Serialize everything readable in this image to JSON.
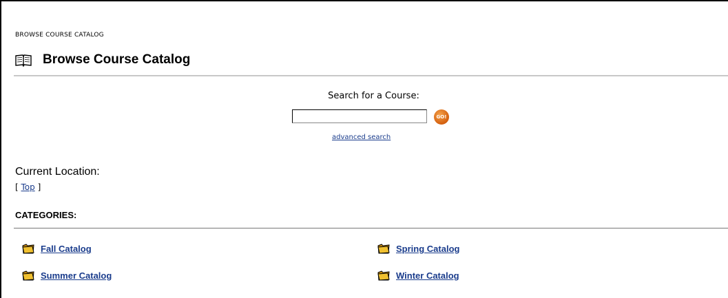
{
  "breadcrumb": "BROWSE COURSE CATALOG",
  "page_title": "Browse Course Catalog",
  "search": {
    "label": "Search for a Course:",
    "value": "",
    "go_label": "GO!",
    "advanced_link": "advanced search"
  },
  "location": {
    "label": "Current Location:",
    "open_bracket": "[",
    "top_link": "Top",
    "close_bracket": "]"
  },
  "categories": {
    "heading": "CATEGORIES:",
    "items": [
      {
        "label": "Fall Catalog"
      },
      {
        "label": "Spring Catalog"
      },
      {
        "label": "Summer Catalog"
      },
      {
        "label": "Winter Catalog"
      }
    ]
  },
  "icons": {
    "page_title_icon": "book-icon",
    "category_icon": "folder-icon"
  },
  "colors": {
    "link": "#1a3c8c",
    "go_button": "#d4600f",
    "folder": "#e8b020"
  }
}
